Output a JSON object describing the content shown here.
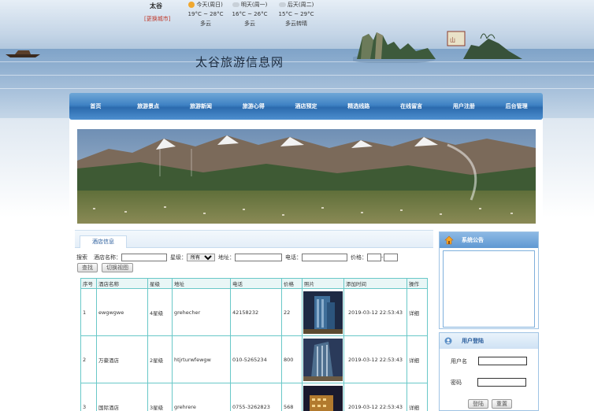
{
  "header": {
    "city": "太谷",
    "switch_city": "[更换城市]",
    "site_title": "太谷旅游信息网",
    "weather": [
      {
        "day": "今天(周日)",
        "temp": "19°C ~ 28°C",
        "desc": "多云",
        "icon": "sun-cloud-icon"
      },
      {
        "day": "明天(周一)",
        "temp": "16°C ~ 26°C",
        "desc": "多云",
        "icon": "cloud-icon"
      },
      {
        "day": "后天(周二)",
        "temp": "15°C ~ 29°C",
        "desc": "多云转晴",
        "icon": "cloud-icon"
      }
    ]
  },
  "nav": [
    "首页",
    "旅游景点",
    "旅游新闻",
    "旅游心得",
    "酒店预定",
    "精选线路",
    "在线留言",
    "用户注册",
    "后台管理"
  ],
  "main": {
    "tab": "酒店信息",
    "search": {
      "prefix": "搜索",
      "name_label": "酒店名称：",
      "star_label": "星级：",
      "star_value": "所有",
      "address_label": "地址：",
      "phone_label": "电话：",
      "price_label": "价格：",
      "price_sep": "-"
    },
    "buttons": {
      "search": "查找",
      "switch_view": "切换视图"
    },
    "columns": [
      "序号",
      "酒店名称",
      "星级",
      "地址",
      "电话",
      "价格",
      "照片",
      "添加时间",
      "操作"
    ],
    "rows": [
      {
        "no": "1",
        "name": "ewgwgwe",
        "star": "4星级",
        "address": "grehecher",
        "phone": "42158232",
        "price": "22",
        "time": "2019-03-12 22:53:43",
        "action": "详细"
      },
      {
        "no": "2",
        "name": "万豪酒店",
        "star": "2星级",
        "address": "htjrturwfewgw",
        "phone": "010-5265234",
        "price": "800",
        "time": "2019-03-12 22:53:43",
        "action": "详细"
      },
      {
        "no": "3",
        "name": "国际酒店",
        "star": "3星级",
        "address": "grehrere",
        "phone": "0755-3262823",
        "price": "568",
        "time": "2019-03-12 22:53:43",
        "action": "详细"
      }
    ]
  },
  "sidebar": {
    "notice_title": "系统公告",
    "login_title": "用户登陆",
    "username_label": "用户名",
    "password_label": "密码",
    "login_button": "登陆",
    "reset_button": "重置"
  }
}
